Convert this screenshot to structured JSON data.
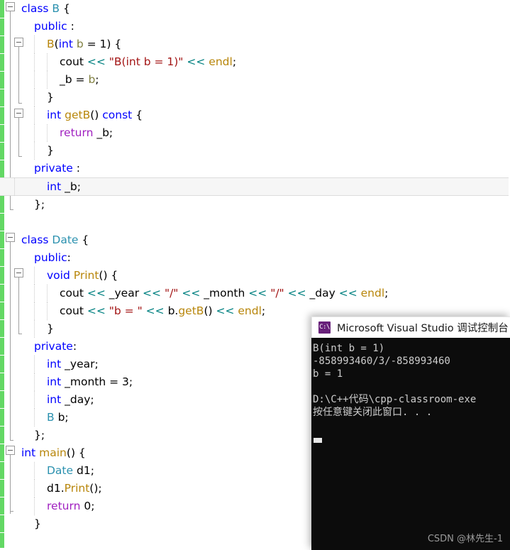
{
  "editor": {
    "name": "visual-studio-code-editor",
    "change_bar_color": "#63d864",
    "current_line_index": 10,
    "lines": [
      {
        "indent": 0,
        "fold": "box",
        "guides": [],
        "tokens": [
          {
            "t": "class",
            "c": "kw"
          },
          {
            "t": " ",
            "c": "punct"
          },
          {
            "t": "B",
            "c": "type"
          },
          {
            "t": " {",
            "c": "punct"
          }
        ]
      },
      {
        "indent": 1,
        "fold": "line",
        "guides": [],
        "tokens": [
          {
            "t": "public",
            "c": "kw"
          },
          {
            "t": " :",
            "c": "punct"
          }
        ]
      },
      {
        "indent": 2,
        "fold": "box",
        "guides": [
          1
        ],
        "tokens": [
          {
            "t": "B",
            "c": "fn"
          },
          {
            "t": "(",
            "c": "punct"
          },
          {
            "t": "int",
            "c": "kw"
          },
          {
            "t": " ",
            "c": "punct"
          },
          {
            "t": "b",
            "c": "param"
          },
          {
            "t": " = ",
            "c": "punct"
          },
          {
            "t": "1",
            "c": "num"
          },
          {
            "t": ") {",
            "c": "punct"
          }
        ]
      },
      {
        "indent": 3,
        "fold": "line",
        "guides": [
          1,
          2
        ],
        "tokens": [
          {
            "t": "cout",
            "c": "id"
          },
          {
            "t": " ",
            "c": "punct"
          },
          {
            "t": "<<",
            "c": "op"
          },
          {
            "t": " ",
            "c": "punct"
          },
          {
            "t": "\"B(int b = 1)\"",
            "c": "str"
          },
          {
            "t": " ",
            "c": "punct"
          },
          {
            "t": "<<",
            "c": "op"
          },
          {
            "t": " ",
            "c": "punct"
          },
          {
            "t": "endl",
            "c": "fn"
          },
          {
            "t": ";",
            "c": "punct"
          }
        ]
      },
      {
        "indent": 3,
        "fold": "line",
        "guides": [
          1,
          2
        ],
        "tokens": [
          {
            "t": "_b",
            "c": "id"
          },
          {
            "t": " = ",
            "c": "punct"
          },
          {
            "t": "b",
            "c": "param"
          },
          {
            "t": ";",
            "c": "punct"
          }
        ]
      },
      {
        "indent": 2,
        "fold": "endline",
        "guides": [
          1
        ],
        "tokens": [
          {
            "t": "}",
            "c": "punct"
          }
        ]
      },
      {
        "indent": 2,
        "fold": "box",
        "guides": [
          1
        ],
        "tokens": [
          {
            "t": "int",
            "c": "kw"
          },
          {
            "t": " ",
            "c": "punct"
          },
          {
            "t": "getB",
            "c": "fn"
          },
          {
            "t": "() ",
            "c": "punct"
          },
          {
            "t": "const",
            "c": "kw"
          },
          {
            "t": " {",
            "c": "punct"
          }
        ]
      },
      {
        "indent": 3,
        "fold": "line",
        "guides": [
          1,
          2
        ],
        "tokens": [
          {
            "t": "return",
            "c": "kwctl"
          },
          {
            "t": " _b;",
            "c": "id"
          }
        ]
      },
      {
        "indent": 2,
        "fold": "endline",
        "guides": [
          1
        ],
        "tokens": [
          {
            "t": "}",
            "c": "punct"
          }
        ]
      },
      {
        "indent": 1,
        "fold": "line",
        "guides": [],
        "tokens": [
          {
            "t": "private",
            "c": "kw"
          },
          {
            "t": " :",
            "c": "punct"
          }
        ]
      },
      {
        "indent": 2,
        "fold": "line",
        "guides": [
          1
        ],
        "tokens": [
          {
            "t": "int",
            "c": "kw"
          },
          {
            "t": " _b;",
            "c": "id"
          }
        ]
      },
      {
        "indent": 1,
        "fold": "endline",
        "guides": [],
        "tokens": [
          {
            "t": "};",
            "c": "punct"
          }
        ]
      },
      {
        "indent": 0,
        "fold": "none",
        "guides": [],
        "tokens": []
      },
      {
        "indent": 0,
        "fold": "box",
        "guides": [],
        "tokens": [
          {
            "t": "class",
            "c": "kw"
          },
          {
            "t": " ",
            "c": "punct"
          },
          {
            "t": "Date",
            "c": "type"
          },
          {
            "t": " {",
            "c": "punct"
          }
        ]
      },
      {
        "indent": 1,
        "fold": "line",
        "guides": [],
        "tokens": [
          {
            "t": "public",
            "c": "kw"
          },
          {
            "t": ":",
            "c": "punct"
          }
        ]
      },
      {
        "indent": 2,
        "fold": "box",
        "guides": [
          1
        ],
        "tokens": [
          {
            "t": "void",
            "c": "kw"
          },
          {
            "t": " ",
            "c": "punct"
          },
          {
            "t": "Print",
            "c": "fn"
          },
          {
            "t": "() {",
            "c": "punct"
          }
        ]
      },
      {
        "indent": 3,
        "fold": "line",
        "guides": [
          1,
          2
        ],
        "tokens": [
          {
            "t": "cout",
            "c": "id"
          },
          {
            "t": " ",
            "c": "punct"
          },
          {
            "t": "<<",
            "c": "op"
          },
          {
            "t": " _year ",
            "c": "id"
          },
          {
            "t": "<<",
            "c": "op"
          },
          {
            "t": " ",
            "c": "punct"
          },
          {
            "t": "\"/\"",
            "c": "str"
          },
          {
            "t": " ",
            "c": "punct"
          },
          {
            "t": "<<",
            "c": "op"
          },
          {
            "t": " _month ",
            "c": "id"
          },
          {
            "t": "<<",
            "c": "op"
          },
          {
            "t": " ",
            "c": "punct"
          },
          {
            "t": "\"/\"",
            "c": "str"
          },
          {
            "t": " ",
            "c": "punct"
          },
          {
            "t": "<<",
            "c": "op"
          },
          {
            "t": " _day ",
            "c": "id"
          },
          {
            "t": "<<",
            "c": "op"
          },
          {
            "t": " ",
            "c": "punct"
          },
          {
            "t": "endl",
            "c": "fn"
          },
          {
            "t": ";",
            "c": "punct"
          }
        ]
      },
      {
        "indent": 3,
        "fold": "line",
        "guides": [
          1,
          2
        ],
        "tokens": [
          {
            "t": "cout",
            "c": "id"
          },
          {
            "t": " ",
            "c": "punct"
          },
          {
            "t": "<<",
            "c": "op"
          },
          {
            "t": " ",
            "c": "punct"
          },
          {
            "t": "\"b = \"",
            "c": "str"
          },
          {
            "t": " ",
            "c": "punct"
          },
          {
            "t": "<<",
            "c": "op"
          },
          {
            "t": " b.",
            "c": "id"
          },
          {
            "t": "getB",
            "c": "fn"
          },
          {
            "t": "() ",
            "c": "punct"
          },
          {
            "t": "<<",
            "c": "op"
          },
          {
            "t": " ",
            "c": "punct"
          },
          {
            "t": "endl",
            "c": "fn"
          },
          {
            "t": ";",
            "c": "punct"
          }
        ]
      },
      {
        "indent": 2,
        "fold": "endline",
        "guides": [
          1
        ],
        "tokens": [
          {
            "t": "}",
            "c": "punct"
          }
        ]
      },
      {
        "indent": 1,
        "fold": "line",
        "guides": [],
        "tokens": [
          {
            "t": "private",
            "c": "kw"
          },
          {
            "t": ":",
            "c": "punct"
          }
        ]
      },
      {
        "indent": 2,
        "fold": "line",
        "guides": [
          1
        ],
        "tokens": [
          {
            "t": "int",
            "c": "kw"
          },
          {
            "t": " _year;",
            "c": "id"
          }
        ]
      },
      {
        "indent": 2,
        "fold": "line",
        "guides": [
          1
        ],
        "tokens": [
          {
            "t": "int",
            "c": "kw"
          },
          {
            "t": " _month = ",
            "c": "id"
          },
          {
            "t": "3",
            "c": "num"
          },
          {
            "t": ";",
            "c": "punct"
          }
        ]
      },
      {
        "indent": 2,
        "fold": "line",
        "guides": [
          1
        ],
        "tokens": [
          {
            "t": "int",
            "c": "kw"
          },
          {
            "t": " _day;",
            "c": "id"
          }
        ]
      },
      {
        "indent": 2,
        "fold": "line",
        "guides": [
          1
        ],
        "tokens": [
          {
            "t": "B",
            "c": "type"
          },
          {
            "t": " b;",
            "c": "id"
          }
        ]
      },
      {
        "indent": 1,
        "fold": "endline",
        "guides": [],
        "tokens": [
          {
            "t": "};",
            "c": "punct"
          }
        ]
      },
      {
        "indent": 0,
        "fold": "box",
        "guides": [],
        "tokens": [
          {
            "t": "int",
            "c": "kw"
          },
          {
            "t": " ",
            "c": "punct"
          },
          {
            "t": "main",
            "c": "fn"
          },
          {
            "t": "() {",
            "c": "punct"
          }
        ]
      },
      {
        "indent": 2,
        "fold": "line",
        "guides": [
          1
        ],
        "tokens": [
          {
            "t": "Date",
            "c": "type"
          },
          {
            "t": " d1;",
            "c": "id"
          }
        ]
      },
      {
        "indent": 2,
        "fold": "line",
        "guides": [
          1
        ],
        "tokens": [
          {
            "t": "d1.",
            "c": "id"
          },
          {
            "t": "Print",
            "c": "fn"
          },
          {
            "t": "();",
            "c": "punct"
          }
        ]
      },
      {
        "indent": 2,
        "fold": "line",
        "guides": [
          1
        ],
        "tokens": [
          {
            "t": "return",
            "c": "kwctl"
          },
          {
            "t": " ",
            "c": "punct"
          },
          {
            "t": "0",
            "c": "num"
          },
          {
            "t": ";",
            "c": "punct"
          }
        ]
      },
      {
        "indent": 1,
        "fold": "endline",
        "guides": [],
        "tokens": [
          {
            "t": "}",
            "c": "punct"
          }
        ]
      }
    ]
  },
  "console": {
    "icon_name": "console-app-icon",
    "icon_glyph": "C:\\",
    "title": "Microsoft Visual Studio 调试控制台",
    "background": "#0c0c0c",
    "foreground": "#cccccc",
    "lines": [
      "B(int b = 1)",
      "-858993460/3/-858993460",
      "b = 1",
      "",
      "D:\\C++代码\\cpp-classroom-exe",
      "按任意键关闭此窗口. . ."
    ],
    "watermark": "CSDN @林先生-1"
  }
}
